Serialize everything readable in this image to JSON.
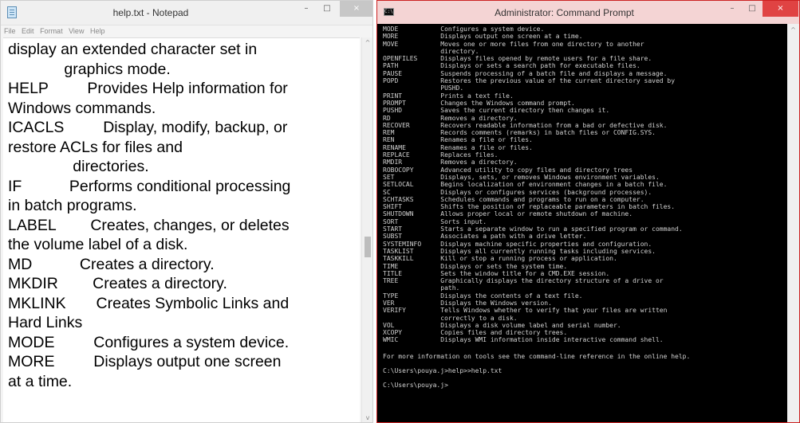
{
  "notepad": {
    "title": "help.txt - Notepad",
    "menu": [
      "File",
      "Edit",
      "Format",
      "View",
      "Help"
    ],
    "text": "display an extended character set in\n             graphics mode.\nHELP         Provides Help information for\nWindows commands.\nICACLS         Display, modify, backup, or\nrestore ACLs for files and\n               directories.\nIF           Performs conditional processing\nin batch programs.\nLABEL        Creates, changes, or deletes\nthe volume label of a disk.\nMD           Creates a directory.\nMKDIR        Creates a directory.\nMKLINK       Creates Symbolic Links and\nHard Links\nMODE         Configures a system device.\nMORE         Displays output one screen\nat a time.",
    "window_buttons": {
      "minimize": "–",
      "maximize": "□",
      "close": "×"
    },
    "scroll_up": "^",
    "scroll_down": "v"
  },
  "cmd": {
    "title": "Administrator: Command Prompt",
    "icon_label": "C:\\",
    "window_buttons": {
      "minimize": "–",
      "maximize": "□",
      "close": "×"
    },
    "scroll_up": "^",
    "lines": [
      "MODE           Configures a system device.",
      "MORE           Displays output one screen at a time.",
      "MOVE           Moves one or more files from one directory to another",
      "               directory.",
      "OPENFILES      Displays files opened by remote users for a file share.",
      "PATH           Displays or sets a search path for executable files.",
      "PAUSE          Suspends processing of a batch file and displays a message.",
      "POPD           Restores the previous value of the current directory saved by",
      "               PUSHD.",
      "PRINT          Prints a text file.",
      "PROMPT         Changes the Windows command prompt.",
      "PUSHD          Saves the current directory then changes it.",
      "RD             Removes a directory.",
      "RECOVER        Recovers readable information from a bad or defective disk.",
      "REM            Records comments (remarks) in batch files or CONFIG.SYS.",
      "REN            Renames a file or files.",
      "RENAME         Renames a file or files.",
      "REPLACE        Replaces files.",
      "RMDIR          Removes a directory.",
      "ROBOCOPY       Advanced utility to copy files and directory trees",
      "SET            Displays, sets, or removes Windows environment variables.",
      "SETLOCAL       Begins localization of environment changes in a batch file.",
      "SC             Displays or configures services (background processes).",
      "SCHTASKS       Schedules commands and programs to run on a computer.",
      "SHIFT          Shifts the position of replaceable parameters in batch files.",
      "SHUTDOWN       Allows proper local or remote shutdown of machine.",
      "SORT           Sorts input.",
      "START          Starts a separate window to run a specified program or command.",
      "SUBST          Associates a path with a drive letter.",
      "SYSTEMINFO     Displays machine specific properties and configuration.",
      "TASKLIST       Displays all currently running tasks including services.",
      "TASKKILL       Kill or stop a running process or application.",
      "TIME           Displays or sets the system time.",
      "TITLE          Sets the window title for a CMD.EXE session.",
      "TREE           Graphically displays the directory structure of a drive or",
      "               path.",
      "TYPE           Displays the contents of a text file.",
      "VER            Displays the Windows version.",
      "VERIFY         Tells Windows whether to verify that your files are written",
      "               correctly to a disk.",
      "VOL            Displays a disk volume label and serial number.",
      "XCOPY          Copies files and directory trees.",
      "WMIC           Displays WMI information inside interactive command shell."
    ],
    "info_line": "For more information on tools see the command-line reference in the online help.",
    "command_line": "C:\\Users\\pouya.j>help>>help.txt",
    "prompt_line": "C:\\Users\\pouya.j>"
  }
}
